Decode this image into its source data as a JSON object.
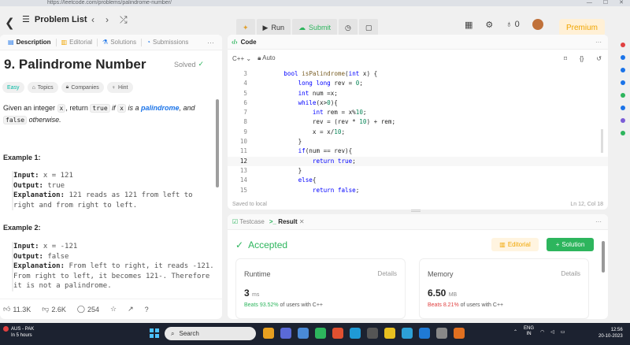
{
  "browser": {
    "url": "https://leetcode.com/problems/palindrome-number/"
  },
  "topbar": {
    "problem_list": "Problem List",
    "run": "Run",
    "submit": "Submit",
    "streak": "0",
    "premium": "Premium"
  },
  "left": {
    "tabs": [
      "Description",
      "Editorial",
      "Solutions",
      "Submissions"
    ],
    "title": "9. Palindrome Number",
    "solved": "Solved",
    "tags": [
      "Easy",
      "Topics",
      "Companies",
      "Hint"
    ],
    "desc_1": "Given an integer ",
    "desc_x": "x",
    "desc_2": ", return ",
    "desc_true": "true",
    "desc_3": " if ",
    "desc_x2": "x",
    "desc_4": " is a ",
    "desc_pal": "palindrome",
    "desc_5": ", and",
    "desc_false": "false",
    "desc_6": " otherwise.",
    "example1": {
      "title": "Example 1:",
      "input_label": "Input:",
      "input": " x = 121",
      "output_label": "Output:",
      "output": " true",
      "expl_label": "Explanation:",
      "expl": " 121 reads as 121 from left to right and from right to left."
    },
    "example2": {
      "title": "Example 2:",
      "input_label": "Input:",
      "input": " x = -121",
      "output_label": "Output:",
      "output": " false",
      "expl_label": "Explanation:",
      "expl": " From left to right, it reads -121. From right to left, it becomes 121-. Therefore it is not a palindrome."
    },
    "footer": {
      "likes": "11.3K",
      "dislikes": "2.6K",
      "comments": "254"
    }
  },
  "editor": {
    "title": "Code",
    "language": "C++",
    "mode": "Auto",
    "lines": [
      {
        "n": "3",
        "t": "    bool isPalindrome(int x) {"
      },
      {
        "n": "4",
        "t": "        long long rev = 0;"
      },
      {
        "n": "5",
        "t": "        int num =x;"
      },
      {
        "n": "6",
        "t": "        while(x>0){"
      },
      {
        "n": "7",
        "t": "            int rem = x%10;"
      },
      {
        "n": "8",
        "t": "            rev = (rev * 10) + rem;"
      },
      {
        "n": "9",
        "t": "            x = x/10;"
      },
      {
        "n": "10",
        "t": "        }"
      },
      {
        "n": "11",
        "t": "        if(num == rev){"
      },
      {
        "n": "12",
        "t": "            return true;"
      },
      {
        "n": "13",
        "t": "        }"
      },
      {
        "n": "14",
        "t": "        else{"
      },
      {
        "n": "15",
        "t": "            return false;"
      }
    ],
    "saved": "Saved to local",
    "cursor": "Ln 12, Col 18"
  },
  "result": {
    "tabs": [
      "Testcase",
      "Result"
    ],
    "status": "Accepted",
    "editorial": "Editorial",
    "solution": "Solution",
    "runtime": {
      "label": "Runtime",
      "details": "Details",
      "value": "3",
      "unit": "ms",
      "beats": "Beats 93.52%",
      "tail": " of users with C++"
    },
    "memory": {
      "label": "Memory",
      "details": "Details",
      "value": "6.50",
      "unit": "MB",
      "beats": "Beats 8.21%",
      "tail": " of users with C++"
    }
  },
  "taskbar": {
    "weather_title": "AUS - PAK",
    "weather_sub": "In 5 hours",
    "search": "Search",
    "lang1": "ENG",
    "lang2": "IN",
    "time": "12:56",
    "date": "20-10-2023"
  }
}
